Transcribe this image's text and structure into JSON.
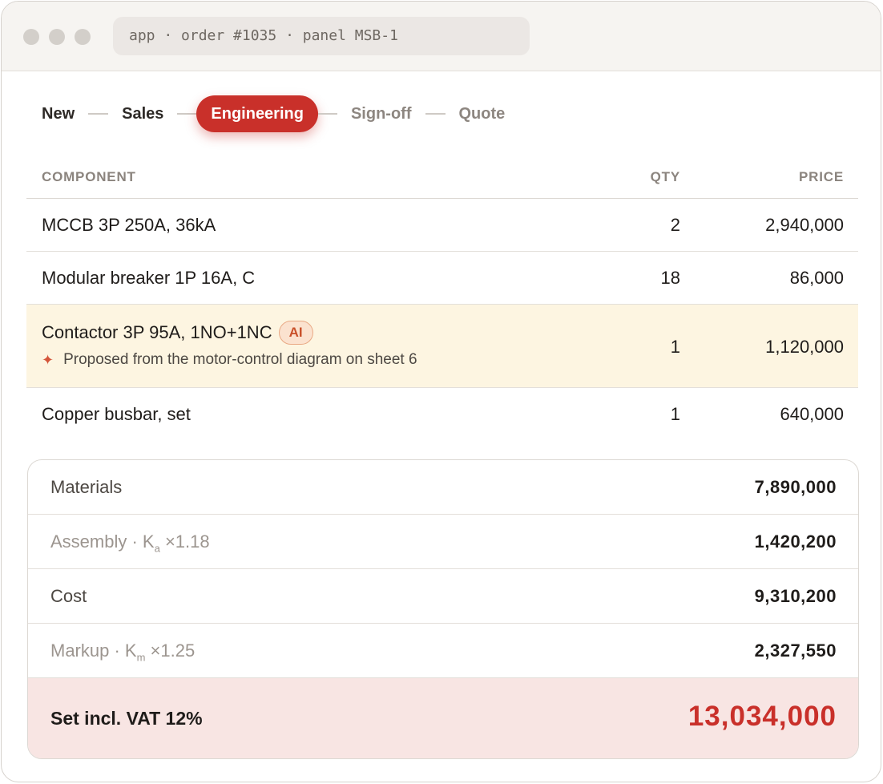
{
  "window": {
    "address": "app · order #1035 · panel MSB-1"
  },
  "stepper": {
    "steps": [
      {
        "label": "New",
        "state": "done"
      },
      {
        "label": "Sales",
        "state": "done"
      },
      {
        "label": "Engineering",
        "state": "active"
      },
      {
        "label": "Sign-off",
        "state": "future"
      },
      {
        "label": "Quote",
        "state": "future"
      }
    ]
  },
  "table": {
    "headers": {
      "component": "COMPONENT",
      "qty": "QTY",
      "price": "PRICE"
    },
    "rows": [
      {
        "component": "MCCB 3P 250A, 36kA",
        "qty": "2",
        "price": "2,940,000"
      },
      {
        "component": "Modular breaker 1P 16A, C",
        "qty": "18",
        "price": "86,000"
      },
      {
        "component": "Contactor 3P 95A, 1NO+1NC",
        "qty": "1",
        "price": "1,120,000",
        "badge": "AI",
        "note": "Proposed from the motor-control diagram on sheet 6",
        "highlight": true
      },
      {
        "component": "Copper busbar, set",
        "qty": "1",
        "price": "640,000"
      }
    ]
  },
  "summary": {
    "materials": {
      "label": "Materials",
      "value": "7,890,000"
    },
    "assembly": {
      "label_prefix": "Assembly · K",
      "label_sub": "a",
      "label_suffix": " ×1.18",
      "value": "1,420,200"
    },
    "cost": {
      "label": "Cost",
      "value": "9,310,200"
    },
    "markup": {
      "label_prefix": "Markup · K",
      "label_sub": "m",
      "label_suffix": " ×1.25",
      "value": "2,327,550"
    },
    "total": {
      "label": "Set incl. VAT 12%",
      "value": "13,034,000"
    }
  },
  "colors": {
    "accent": "#c9302a",
    "ai_highlight": "#fdf5e1",
    "total_bg": "#f8e5e3"
  },
  "icons": {
    "sparkle": "sparkle-icon"
  }
}
